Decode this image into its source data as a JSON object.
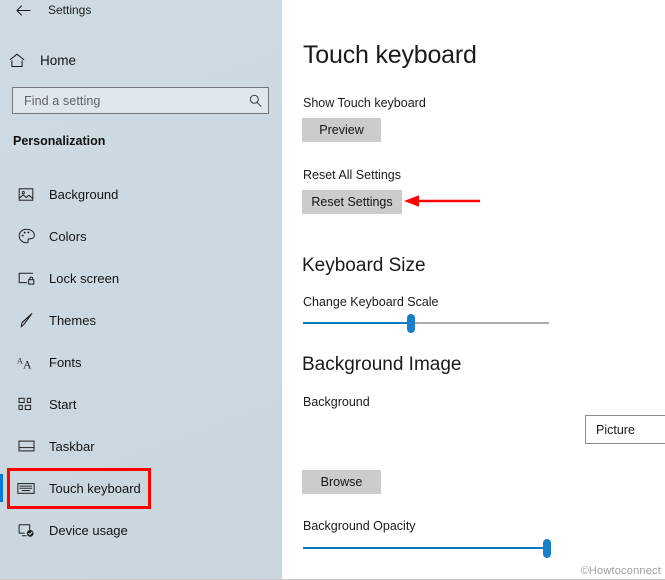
{
  "window": {
    "titlebar_text": "Settings",
    "back_icon": "back-arrow-icon"
  },
  "sidebar": {
    "home": {
      "label": "Home",
      "icon": "home-icon"
    },
    "search": {
      "placeholder": "Find a setting",
      "value": "",
      "icon": "search-icon"
    },
    "section_header": "Personalization",
    "items": [
      {
        "label": "Background",
        "icon": "picture-icon",
        "selected": false
      },
      {
        "label": "Colors",
        "icon": "palette-icon",
        "selected": false
      },
      {
        "label": "Lock screen",
        "icon": "lock-screen-icon",
        "selected": false
      },
      {
        "label": "Themes",
        "icon": "brush-icon",
        "selected": false
      },
      {
        "label": "Fonts",
        "icon": "font-aa-icon",
        "selected": false
      },
      {
        "label": "Start",
        "icon": "start-tiles-icon",
        "selected": false
      },
      {
        "label": "Taskbar",
        "icon": "taskbar-icon",
        "selected": false
      },
      {
        "label": "Touch keyboard",
        "icon": "keyboard-icon",
        "selected": true
      },
      {
        "label": "Device usage",
        "icon": "device-usage-icon",
        "selected": false
      }
    ]
  },
  "main": {
    "page_title": "Touch keyboard",
    "show_touch_keyboard": {
      "label": "Show Touch keyboard",
      "button_label": "Preview"
    },
    "reset_all_settings": {
      "label": "Reset All Settings",
      "button_label": "Reset Settings"
    },
    "keyboard_size": {
      "heading": "Keyboard Size",
      "slider_label": "Change Keyboard Scale",
      "slider_value_percent": 44
    },
    "background_image": {
      "heading": "Background Image",
      "background_label": "Background",
      "dropdown_value": "Picture",
      "dropdown_icon": "chevron-down-icon",
      "browse_button_label": "Browse",
      "opacity_label": "Background Opacity",
      "opacity_value_percent": 99
    }
  },
  "annotations": {
    "highlight_box_target": "Touch keyboard",
    "arrow_target": "Reset Settings",
    "color": "#ff0000"
  },
  "watermark": "©Howtoconnect",
  "colors": {
    "accent": "#0078d7",
    "sidebar_bg": "#cdd9e1",
    "button_bg": "#cccccc",
    "slider_fill": "#0a7ac4",
    "slider_rest": "#adadad"
  }
}
